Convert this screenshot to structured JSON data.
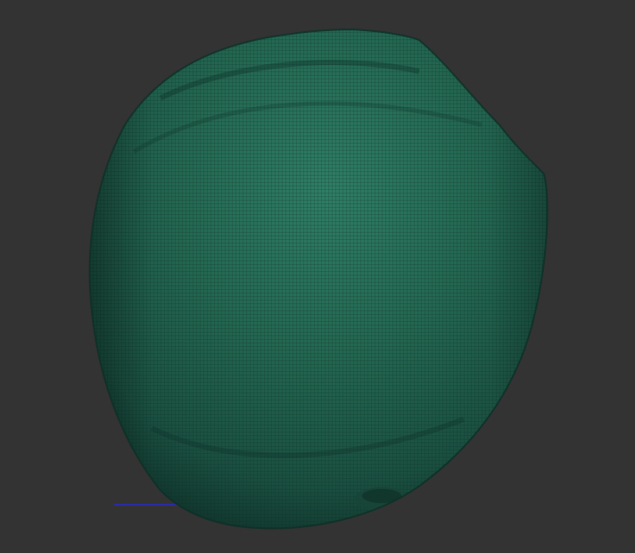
{
  "viewport": {
    "background_color": "#333333",
    "model": {
      "name": "mesh-model",
      "base_color": "#1f5a4a",
      "highlight_color": "#2e7a62",
      "shadow_color": "#0f3028",
      "wire_color": "#0b2a22"
    },
    "axis": {
      "name": "x-axis-indicator",
      "color": "#2a2aa8"
    }
  }
}
